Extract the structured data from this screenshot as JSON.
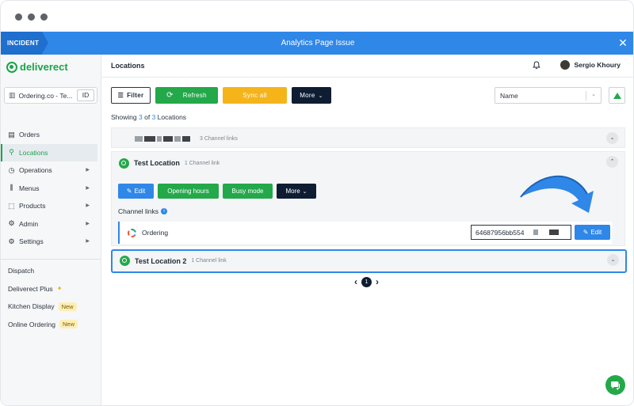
{
  "incident": {
    "tag": "INCIDENT",
    "title": "Analytics Page Issue",
    "close": "✕"
  },
  "sidebar": {
    "brand": "deliverect",
    "account_name": "Ordering.co - Te...",
    "account_id": "ID",
    "items": [
      {
        "label": "Orders",
        "icon": "orders-icon",
        "glyph": "▤"
      },
      {
        "label": "Locations",
        "icon": "location-pin-icon",
        "glyph": "⚲"
      },
      {
        "label": "Operations",
        "icon": "operations-icon",
        "glyph": "◷"
      },
      {
        "label": "Menus",
        "icon": "menus-icon",
        "glyph": "⫼"
      },
      {
        "label": "Products",
        "icon": "products-icon",
        "glyph": "⬚"
      },
      {
        "label": "Admin",
        "icon": "admin-icon",
        "glyph": "⚙"
      },
      {
        "label": "Settings",
        "icon": "settings-icon",
        "glyph": "⚙"
      }
    ],
    "bottom_items": [
      {
        "label": "Dispatch"
      },
      {
        "label": "Deliverect Plus",
        "extra": "✦"
      },
      {
        "label": "Kitchen Display",
        "badge": "New"
      },
      {
        "label": "Online Ordering",
        "badge": "New"
      }
    ]
  },
  "header": {
    "title": "Locations",
    "user_name": "Sergio Khoury"
  },
  "toolbar": {
    "filter": "Filter",
    "refresh": "Refresh",
    "sync_all": "Sync all",
    "more": "More"
  },
  "sort": {
    "value": "Name"
  },
  "showing": {
    "prefix": "Showing",
    "shown": "3",
    "of": "of",
    "total": "3",
    "suffix": "Locations"
  },
  "locations": [
    {
      "name": "",
      "links": "3 Channel links"
    },
    {
      "name": "Test Location",
      "links": "1 Channel link"
    },
    {
      "name": "Test Location 2",
      "links": "1 Channel link"
    }
  ],
  "location_actions": {
    "edit": "Edit",
    "opening_hours": "Opening hours",
    "busy_mode": "Busy mode",
    "more": "More"
  },
  "channel_links": {
    "title": "Channel links",
    "channel_name": "Ordering",
    "channel_id": "64687956bb554",
    "edit": "Edit"
  },
  "pager": {
    "current": "1"
  },
  "colors": {
    "brand_green": "#23a84a",
    "accent_blue": "#2f87e8",
    "sync_yellow": "#f5b41a",
    "navy": "#0f1d33"
  }
}
